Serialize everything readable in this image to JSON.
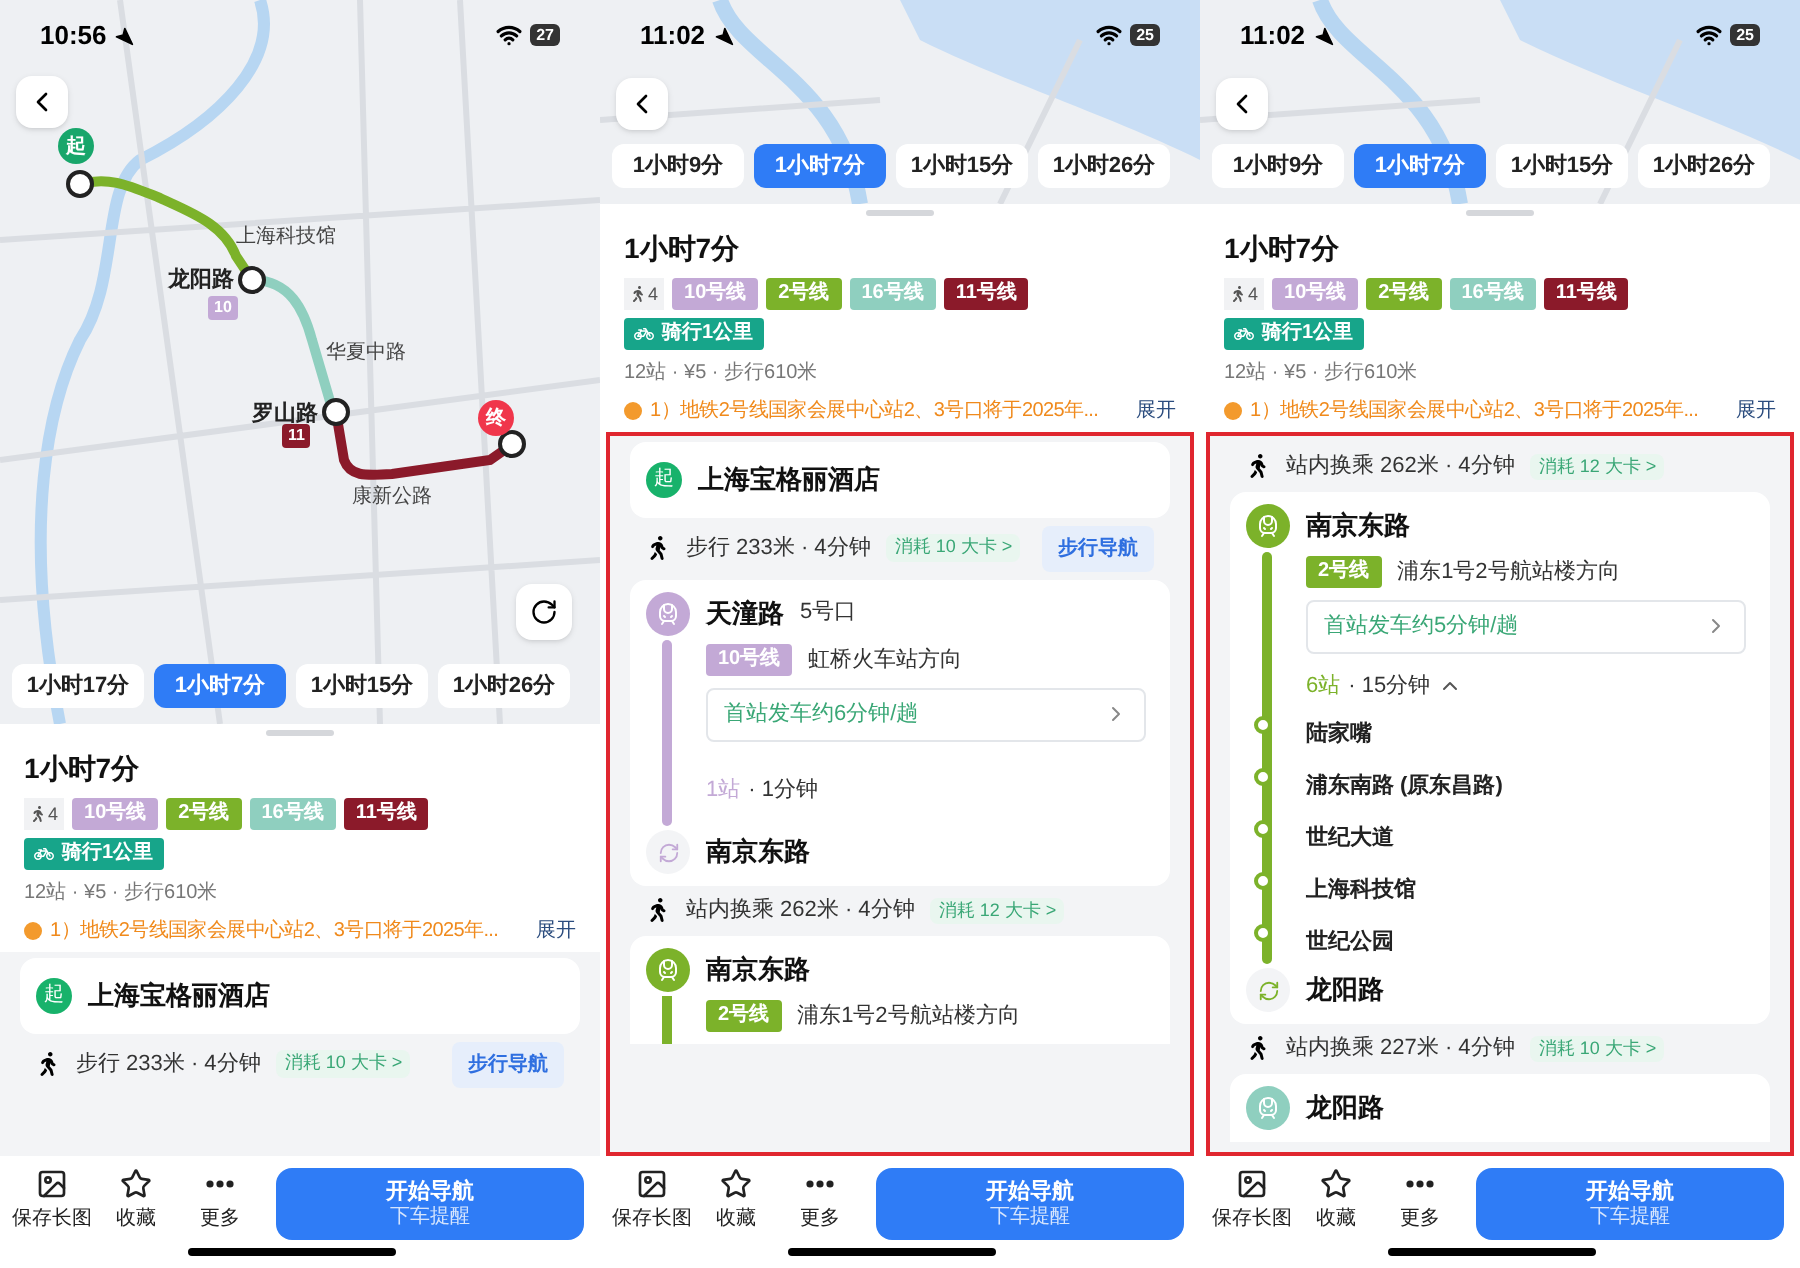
{
  "phones": [
    {
      "status": {
        "time": "10:56",
        "battery": "27"
      },
      "map": {
        "kind": "detailed",
        "pins": [
          {
            "kind": "start",
            "label": "起"
          },
          {
            "kind": "end",
            "label": "终"
          }
        ],
        "labels": [
          {
            "kind": "minor",
            "text": "上海科技馆"
          },
          {
            "kind": "major",
            "text": "龙阳路"
          },
          {
            "kind": "badge",
            "text": "10",
            "color": "#c3a9d6"
          },
          {
            "kind": "minor",
            "text": "华夏中路"
          },
          {
            "kind": "major",
            "text": "罗山路"
          },
          {
            "kind": "badge",
            "text": "11",
            "color": "#8b1a2a"
          },
          {
            "kind": "minor",
            "text": "康新公路"
          }
        ]
      },
      "highlighted": false,
      "route_options": [
        {
          "label": "1小时17分",
          "selected": false
        },
        {
          "label": "1小时7分",
          "selected": true
        },
        {
          "label": "1小时15分",
          "selected": false
        },
        {
          "label": "1小时26分",
          "selected": false
        }
      ],
      "summary": {
        "title": "1小时7分",
        "walk_count": "4",
        "lines": [
          {
            "label": "10号线",
            "color": "#c3a9d6"
          },
          {
            "label": "2号线",
            "color": "#7cb22a"
          },
          {
            "label": "16号线",
            "color": "#8fcfbf"
          },
          {
            "label": "11号线",
            "color": "#8b1a2a"
          }
        ],
        "bike": "骑行1公里",
        "meta": "12站 · ¥5 · 步行610米",
        "notice": "1）地铁2号线国家会展中心站2、3号口将于2025年...",
        "expand": "展开"
      },
      "steps": [
        {
          "kind": "origin",
          "badge": "起",
          "name": "上海宝格丽酒店"
        },
        {
          "kind": "walk",
          "text": "步行 233米 · 4分钟",
          "calories": "消耗 10 大卡 >",
          "button": "步行导航"
        }
      ],
      "actions": [
        {
          "kind": "image",
          "label": "保存长图"
        },
        {
          "kind": "star",
          "label": "收藏"
        },
        {
          "kind": "more",
          "label": "更多"
        }
      ],
      "primary": {
        "title": "开始导航",
        "subtitle": "下车提醒"
      }
    },
    {
      "status": {
        "time": "11:02",
        "battery": "25"
      },
      "map": {
        "kind": "simple"
      },
      "highlighted": true,
      "route_options": [
        {
          "label": "1小时9分",
          "selected": false
        },
        {
          "label": "1小时7分",
          "selected": true
        },
        {
          "label": "1小时15分",
          "selected": false
        },
        {
          "label": "1小时26分",
          "selected": false
        }
      ],
      "summary": {
        "title": "1小时7分",
        "walk_count": "4",
        "lines": [
          {
            "label": "10号线",
            "color": "#c3a9d6"
          },
          {
            "label": "2号线",
            "color": "#7cb22a"
          },
          {
            "label": "16号线",
            "color": "#8fcfbf"
          },
          {
            "label": "11号线",
            "color": "#8b1a2a"
          }
        ],
        "bike": "骑行1公里",
        "meta": "12站 · ¥5 · 步行610米",
        "notice": "1）地铁2号线国家会展中心站2、3号口将于2025年...",
        "expand": "展开"
      },
      "steps": [
        {
          "kind": "origin",
          "badge": "起",
          "name": "上海宝格丽酒店"
        },
        {
          "kind": "walk",
          "text": "步行 233米 · 4分钟",
          "calories": "消耗 10 大卡 >",
          "button": "步行导航"
        },
        {
          "kind": "ride",
          "station": "天潼路",
          "exit": "5号口",
          "line": {
            "label": "10号线",
            "color": "#c3a9d6"
          },
          "direction": "虹桥火车站方向",
          "frequency": "首站发车约6分钟/趟",
          "stops": "1站",
          "duration": "· 1分钟",
          "expanded": false,
          "end_station": "南京东路"
        },
        {
          "kind": "walk",
          "text": "站内换乘 262米 · 4分钟",
          "calories": "消耗 12 大卡 >"
        },
        {
          "kind": "station",
          "station": "南京东路",
          "line": {
            "label": "2号线",
            "color": "#7cb22a"
          },
          "direction": "浦东1号2号航站楼方向"
        }
      ],
      "actions": [
        {
          "kind": "image",
          "label": "保存长图"
        },
        {
          "kind": "star",
          "label": "收藏"
        },
        {
          "kind": "more",
          "label": "更多"
        }
      ],
      "primary": {
        "title": "开始导航",
        "subtitle": "下车提醒"
      }
    },
    {
      "status": {
        "time": "11:02",
        "battery": "25"
      },
      "map": {
        "kind": "simple"
      },
      "highlighted": true,
      "route_options": [
        {
          "label": "1小时9分",
          "selected": false
        },
        {
          "label": "1小时7分",
          "selected": true
        },
        {
          "label": "1小时15分",
          "selected": false
        },
        {
          "label": "1小时26分",
          "selected": false
        }
      ],
      "summary": {
        "title": "1小时7分",
        "walk_count": "4",
        "lines": [
          {
            "label": "10号线",
            "color": "#c3a9d6"
          },
          {
            "label": "2号线",
            "color": "#7cb22a"
          },
          {
            "label": "16号线",
            "color": "#8fcfbf"
          },
          {
            "label": "11号线",
            "color": "#8b1a2a"
          }
        ],
        "bike": "骑行1公里",
        "meta": "12站 · ¥5 · 步行610米",
        "notice": "1）地铁2号线国家会展中心站2、3号口将于2025年...",
        "expand": "展开"
      },
      "steps": [
        {
          "kind": "walk",
          "text": "站内换乘 262米 · 4分钟",
          "calories": "消耗 12 大卡 >"
        },
        {
          "kind": "ride",
          "station": "南京东路",
          "line": {
            "label": "2号线",
            "color": "#7cb22a"
          },
          "direction": "浦东1号2号航站楼方向",
          "frequency": "首站发车约5分钟/趟",
          "stops": "6站",
          "duration": "· 15分钟",
          "expanded": true,
          "intermediate": [
            "陆家嘴",
            "浦东南路 (原东昌路)",
            "世纪大道",
            "上海科技馆",
            "世纪公园"
          ],
          "end_station": "龙阳路"
        },
        {
          "kind": "walk",
          "text": "站内换乘 227米 · 4分钟",
          "calories": "消耗 10 大卡 >"
        },
        {
          "kind": "station",
          "station": "龙阳路",
          "line": {
            "color": "#8fcfbf"
          }
        }
      ],
      "actions": [
        {
          "kind": "image",
          "label": "保存长图"
        },
        {
          "kind": "star",
          "label": "收藏"
        },
        {
          "kind": "more",
          "label": "更多"
        }
      ],
      "primary": {
        "title": "开始导航",
        "subtitle": "下车提醒"
      }
    }
  ]
}
